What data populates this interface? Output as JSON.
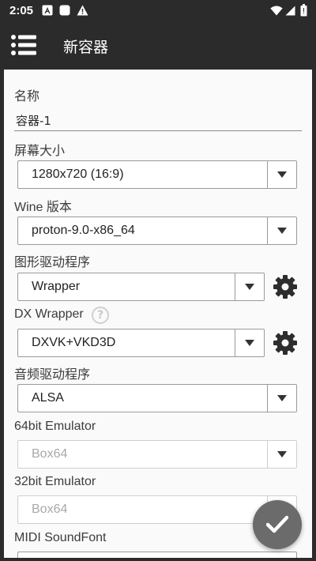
{
  "status_bar": {
    "time": "2:05",
    "indicators": [
      "a-notification-icon",
      "square-notification-icon",
      "alert-icon"
    ],
    "right_icons": [
      "wifi-icon",
      "signal-icon",
      "battery-icon"
    ]
  },
  "app_bar": {
    "title": "新容器",
    "menu_icon": "list-menu-icon"
  },
  "form": {
    "name": {
      "label": "名称",
      "value": "容器-1"
    },
    "screen_size": {
      "label": "屏幕大小",
      "value": "1280x720 (16:9)"
    },
    "wine_version": {
      "label": "Wine 版本",
      "value": "proton-9.0-x86_64"
    },
    "graphics_driver": {
      "label": "图形驱动程序",
      "value": "Wrapper",
      "settings_icon": "gear-icon"
    },
    "dx_wrapper": {
      "label": "DX Wrapper",
      "value": "DXVK+VKD3D",
      "help_icon": "?",
      "settings_icon": "gear-icon"
    },
    "audio_driver": {
      "label": "音频驱动程序",
      "value": "ALSA"
    },
    "emulator_64": {
      "label": "64bit Emulator",
      "value": "Box64",
      "disabled": true
    },
    "emulator_32": {
      "label": "32bit Emulator",
      "value": "Box64",
      "disabled": true
    },
    "midi_soundfont": {
      "label": "MIDI SoundFont"
    }
  },
  "fab": {
    "icon": "check-icon"
  },
  "colors": {
    "app_bar": "#2b2b2b",
    "background": "#fafafa",
    "fab": "#6b6b6b",
    "disabled_text": "#a8a8a8"
  }
}
